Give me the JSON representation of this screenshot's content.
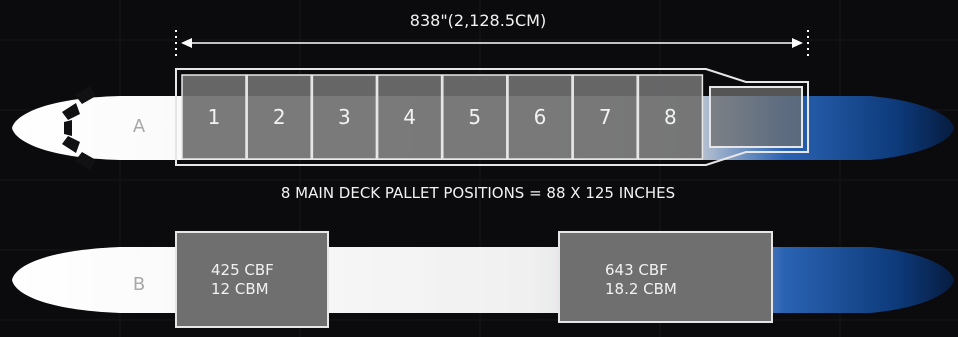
{
  "dimension": {
    "label": "838\"(2,128.5CM)"
  },
  "deck_a": {
    "label": "A",
    "positions": [
      "1",
      "2",
      "3",
      "4",
      "5",
      "6",
      "7",
      "8"
    ],
    "caption": "8 MAIN DECK PALLET POSITIONS = 88 X 125 INCHES"
  },
  "deck_b": {
    "label": "B",
    "forward_hold": {
      "line1": "425 CBF",
      "line2": "12 CBM"
    },
    "aft_hold": {
      "line1": "643 CBF",
      "line2": "18.2 CBM"
    }
  },
  "colors": {
    "background": "#0b0b0d",
    "fuselage": "#ffffff",
    "nose_blue": "#1f5aa8",
    "pallet_fill": "#6f6f6f",
    "outline": "#e6e6e6",
    "text_light": "#f2f2f2",
    "label_gray": "#a8a8a8"
  },
  "icons": {
    "cockpit": "cockpit-windows-icon"
  }
}
